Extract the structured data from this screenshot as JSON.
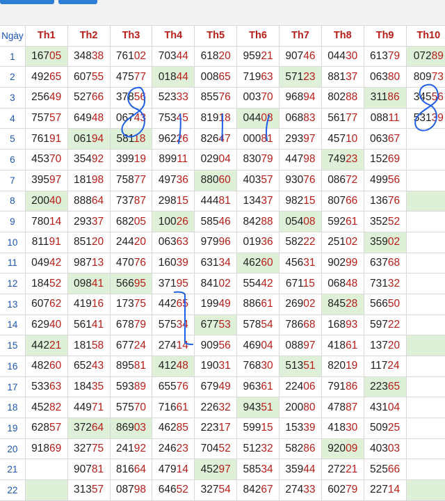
{
  "headers": {
    "day": "Ngày",
    "months": [
      "Th1",
      "Th2",
      "Th3",
      "Th4",
      "Th5",
      "Th6",
      "Th7",
      "Th8",
      "Th9",
      "Th10"
    ]
  },
  "rows": [
    {
      "day": "1",
      "cells": [
        "16705",
        "34838",
        "76102",
        "70344",
        "61820",
        "95921",
        "90746",
        "04430",
        "61379",
        "07289"
      ],
      "hl": [
        0,
        9
      ]
    },
    {
      "day": "2",
      "cells": [
        "49265",
        "60755",
        "47577",
        "01844",
        "00865",
        "71963",
        "57123",
        "88137",
        "06380",
        "80973"
      ],
      "hl": [
        3,
        6
      ]
    },
    {
      "day": "3",
      "cells": [
        "25649",
        "52766",
        "37856",
        "52333",
        "85576",
        "00370",
        "96894",
        "80288",
        "31186",
        "34556"
      ],
      "hl": [
        8
      ]
    },
    {
      "day": "4",
      "cells": [
        "75757",
        "64948",
        "06743",
        "75345",
        "81918",
        "04408",
        "06883",
        "56177",
        "08811",
        "53139"
      ],
      "hl": [
        5
      ]
    },
    {
      "day": "5",
      "cells": [
        "76191",
        "06194",
        "58118",
        "96226",
        "82647",
        "00081",
        "29397",
        "45710",
        "06367",
        ""
      ],
      "hl": [
        1,
        2
      ]
    },
    {
      "day": "6",
      "cells": [
        "45370",
        "35492",
        "39919",
        "89911",
        "02904",
        "83079",
        "44798",
        "74923",
        "15269",
        ""
      ],
      "hl": [
        7
      ]
    },
    {
      "day": "7",
      "cells": [
        "39597",
        "18198",
        "75877",
        "49736",
        "88060",
        "40357",
        "93076",
        "08672",
        "49956",
        ""
      ],
      "hl": [
        4
      ]
    },
    {
      "day": "8",
      "cells": [
        "20040",
        "88864",
        "73787",
        "29815",
        "44481",
        "13437",
        "98215",
        "80766",
        "13676",
        ""
      ],
      "hl": [
        0,
        9
      ]
    },
    {
      "day": "9",
      "cells": [
        "78014",
        "29337",
        "68205",
        "10026",
        "58546",
        "84288",
        "05408",
        "59261",
        "35252",
        ""
      ],
      "hl": [
        3,
        6
      ]
    },
    {
      "day": "10",
      "cells": [
        "81191",
        "85120",
        "24420",
        "06363",
        "97996",
        "01936",
        "58222",
        "25102",
        "35902",
        ""
      ],
      "hl": [
        8
      ]
    },
    {
      "day": "11",
      "cells": [
        "04942",
        "98713",
        "47076",
        "16039",
        "63134",
        "46260",
        "45631",
        "90299",
        "63768",
        ""
      ],
      "hl": [
        5
      ]
    },
    {
      "day": "12",
      "cells": [
        "18452",
        "09841",
        "56695",
        "37195",
        "84102",
        "55442",
        "67115",
        "06848",
        "73132",
        ""
      ],
      "hl": [
        1,
        2
      ]
    },
    {
      "day": "13",
      "cells": [
        "60762",
        "41916",
        "17375",
        "44265",
        "19949",
        "88661",
        "26902",
        "84528",
        "56650",
        ""
      ],
      "hl": [
        7
      ]
    },
    {
      "day": "14",
      "cells": [
        "62940",
        "56141",
        "67879",
        "57534",
        "67753",
        "57854",
        "78668",
        "16893",
        "59722",
        ""
      ],
      "hl": [
        4
      ]
    },
    {
      "day": "15",
      "cells": [
        "44221",
        "18158",
        "67724",
        "27414",
        "90956",
        "46904",
        "08897",
        "41861",
        "13720",
        ""
      ],
      "hl": [
        0,
        9
      ]
    },
    {
      "day": "16",
      "cells": [
        "48260",
        "65243",
        "89581",
        "41248",
        "19031",
        "76830",
        "51351",
        "82019",
        "11724",
        ""
      ],
      "hl": [
        3,
        6
      ]
    },
    {
      "day": "17",
      "cells": [
        "53363",
        "18435",
        "59389",
        "65576",
        "67949",
        "96361",
        "22406",
        "79186",
        "22365",
        ""
      ],
      "hl": [
        8
      ]
    },
    {
      "day": "18",
      "cells": [
        "45282",
        "44971",
        "57570",
        "71661",
        "22632",
        "94351",
        "20080",
        "47887",
        "43104",
        ""
      ],
      "hl": [
        5
      ]
    },
    {
      "day": "19",
      "cells": [
        "62857",
        "37264",
        "86903",
        "46285",
        "22317",
        "59915",
        "15339",
        "41830",
        "50925",
        ""
      ],
      "hl": [
        1,
        2
      ]
    },
    {
      "day": "20",
      "cells": [
        "91869",
        "32775",
        "24192",
        "24623",
        "70452",
        "51232",
        "58286",
        "92009",
        "40303",
        ""
      ],
      "hl": [
        7
      ]
    },
    {
      "day": "21",
      "cells": [
        "",
        "90781",
        "81664",
        "47914",
        "45297",
        "58534",
        "35944",
        "27221",
        "52566",
        ""
      ],
      "hl": [
        4
      ]
    },
    {
      "day": "22",
      "cells": [
        "",
        "31357",
        "08798",
        "64652",
        "32754",
        "84267",
        "27433",
        "60279",
        "22714",
        ""
      ],
      "hl": [
        0,
        9
      ]
    }
  ]
}
